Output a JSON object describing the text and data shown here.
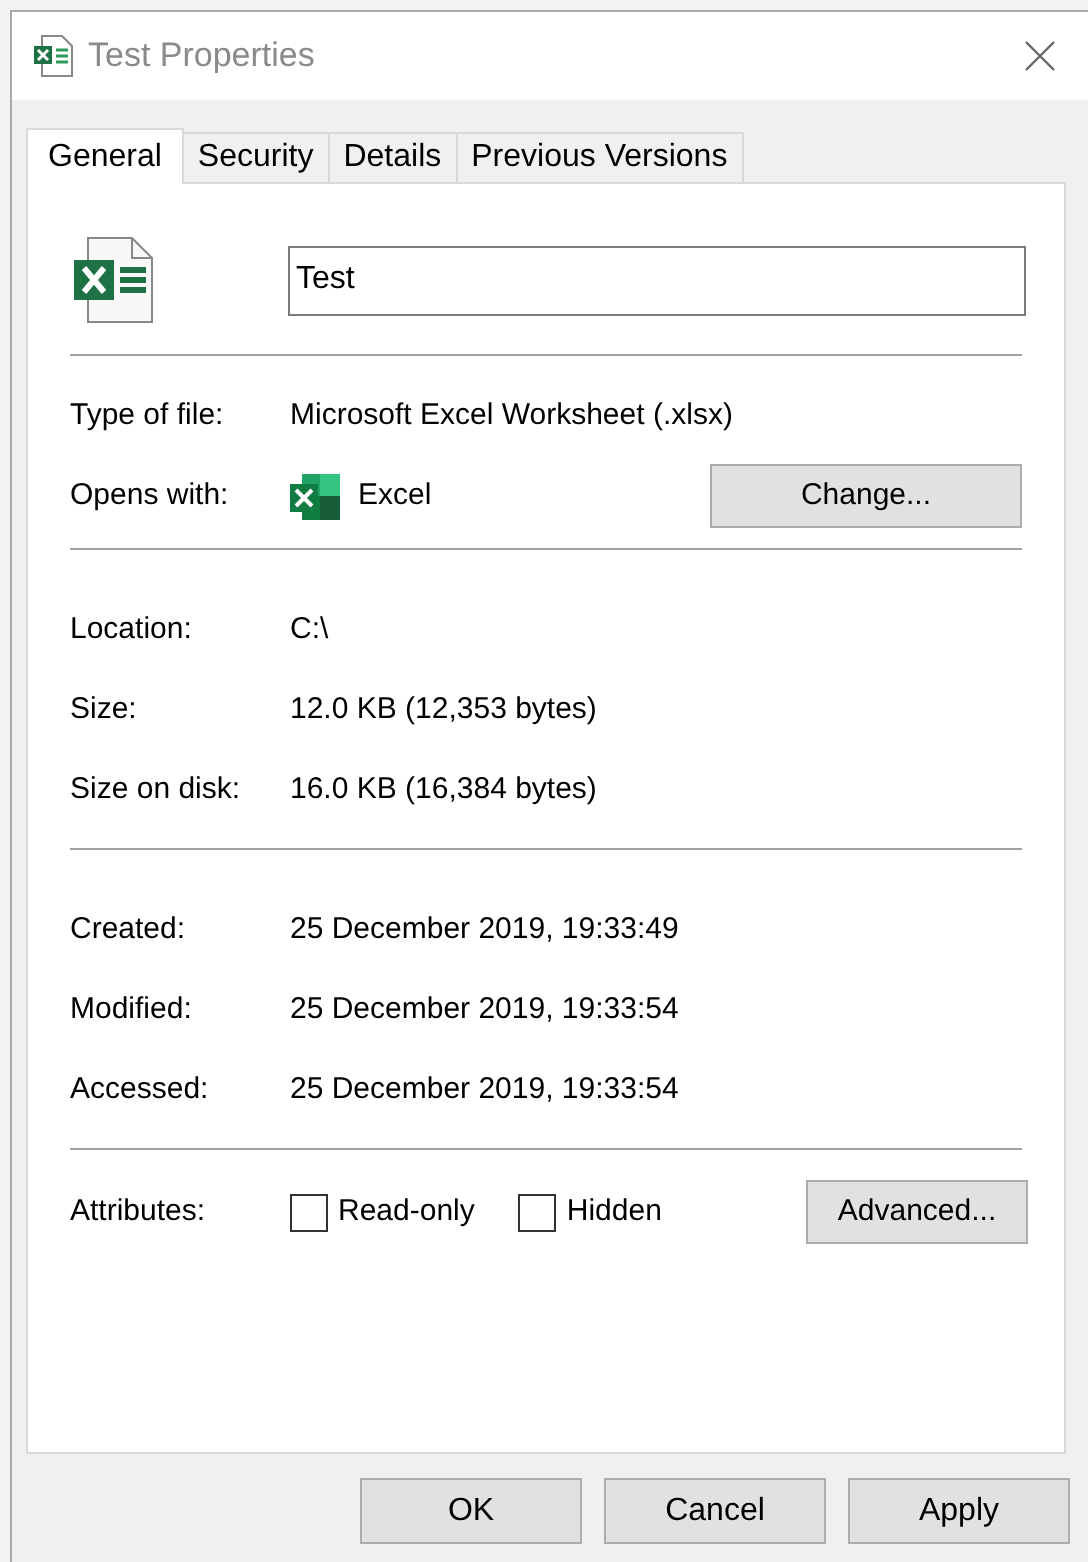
{
  "window": {
    "title": "Test Properties"
  },
  "tabs": [
    {
      "label": "General",
      "selected": true
    },
    {
      "label": "Security",
      "selected": false
    },
    {
      "label": "Details",
      "selected": false
    },
    {
      "label": "Previous Versions",
      "selected": false
    }
  ],
  "file_name": "Test",
  "type_section": [
    {
      "label": "Type of file:",
      "value": "Microsoft Excel Worksheet (.xlsx)"
    },
    {
      "label": "Opens with:",
      "value": "Excel",
      "kind": "app",
      "button": "Change..."
    }
  ],
  "location_section": [
    {
      "label": "Location:",
      "value": "C:\\"
    },
    {
      "label": "Size:",
      "value": "12.0 KB (12,353 bytes)"
    },
    {
      "label": "Size on disk:",
      "value": "16.0 KB (16,384 bytes)"
    }
  ],
  "dates_section": [
    {
      "label": "Created:",
      "value": "25 December 2019, 19:33:49"
    },
    {
      "label": "Modified:",
      "value": "25 December 2019, 19:33:54"
    },
    {
      "label": "Accessed:",
      "value": "25 December 2019, 19:33:54"
    }
  ],
  "attributes": {
    "label": "Attributes:",
    "options": [
      {
        "label": "Read-only",
        "checked": false
      },
      {
        "label": "Hidden",
        "checked": false
      }
    ],
    "button": "Advanced..."
  },
  "buttons": [
    "OK",
    "Cancel",
    "Apply"
  ]
}
